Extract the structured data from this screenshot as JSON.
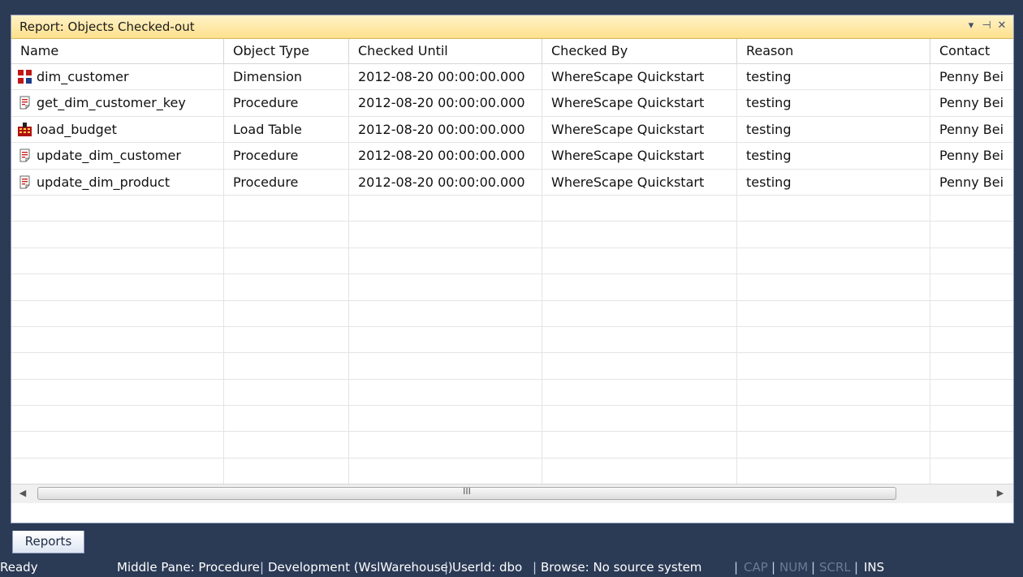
{
  "panel": {
    "title": "Report: Objects Checked-out",
    "buttons": [
      "▾",
      "⊣",
      "✕"
    ]
  },
  "columns": [
    "Name",
    "Object Type",
    "Checked Until",
    "Checked By",
    "Reason",
    "Contact"
  ],
  "rows": [
    {
      "icon": "dimension-icon",
      "name": "dim_customer",
      "type": "Dimension",
      "until": "2012-08-20 00:00:00.000",
      "by": "WhereScape Quickstart",
      "reason": "testing",
      "contact": "Penny Bei"
    },
    {
      "icon": "procedure-icon",
      "name": "get_dim_customer_key",
      "type": "Procedure",
      "until": "2012-08-20 00:00:00.000",
      "by": "WhereScape Quickstart",
      "reason": "testing",
      "contact": "Penny Bei"
    },
    {
      "icon": "load-table-icon",
      "name": "load_budget",
      "type": "Load Table",
      "until": "2012-08-20 00:00:00.000",
      "by": "WhereScape Quickstart",
      "reason": "testing",
      "contact": "Penny Bei"
    },
    {
      "icon": "procedure-icon",
      "name": "update_dim_customer",
      "type": "Procedure",
      "until": "2012-08-20 00:00:00.000",
      "by": "WhereScape Quickstart",
      "reason": "testing",
      "contact": "Penny Bei"
    },
    {
      "icon": "procedure-icon",
      "name": "update_dim_product",
      "type": "Procedure",
      "until": "2012-08-20 00:00:00.000",
      "by": "WhereScape Quickstart",
      "reason": "testing",
      "contact": "Penny Bei"
    }
  ],
  "scrollbar": {
    "left": "◀",
    "right": "▶",
    "grip": "III"
  },
  "tab": {
    "label": "Reports"
  },
  "status": {
    "ready": "Ready",
    "middle_pane": "Middle Pane: Procedure",
    "connection": "Development (WslWarehouse)",
    "user": "UserId: dbo",
    "browse": "Browse: No source system",
    "cap": "CAP",
    "num": "NUM",
    "scrl": "SCRL",
    "ins": "INS",
    "separator": "|"
  }
}
